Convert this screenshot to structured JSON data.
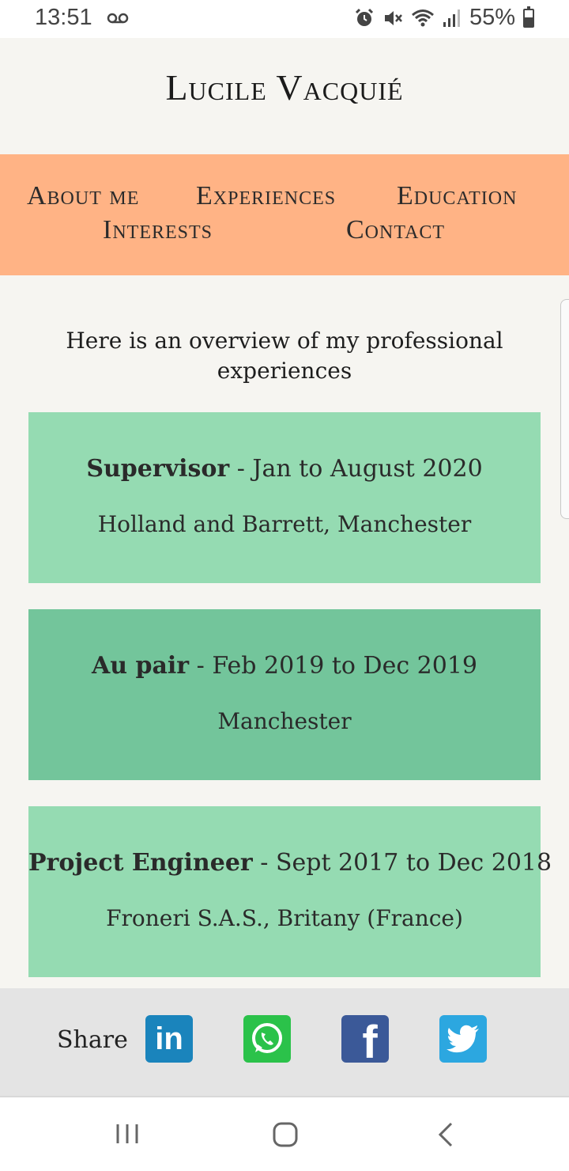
{
  "status_bar": {
    "time": "13:51",
    "battery": "55%",
    "icons": [
      "voicemail-icon",
      "alarm-icon",
      "mute-icon",
      "wifi-icon",
      "signal-icon",
      "battery-icon"
    ]
  },
  "site": {
    "title": "Lucile Vacquié"
  },
  "nav": {
    "items": [
      {
        "label": "About me"
      },
      {
        "label": "Experiences"
      },
      {
        "label": "Education"
      },
      {
        "label": "Interests"
      },
      {
        "label": "Contact"
      }
    ],
    "background": "#ffb385"
  },
  "main": {
    "heading": "Here is an overview of my professional experiences",
    "experiences": [
      {
        "role": "Supervisor",
        "period": " - Jan to August 2020",
        "place": "Holland and Barrett, Manchester",
        "color": "#95dbb2"
      },
      {
        "role": "Au pair",
        "period": " - Feb 2019 to Dec 2019",
        "place": "Manchester",
        "color": "#73c59b"
      },
      {
        "role": "Project Engineer",
        "period": " - Sept 2017 to Dec 2018",
        "place": "Froneri S.A.S., Britany (France)",
        "color": "#95dbb2"
      }
    ]
  },
  "share": {
    "label": "Share",
    "buttons": [
      {
        "icon": "linkedin-icon",
        "color": "#1a84bc",
        "glyph": "in"
      },
      {
        "icon": "whatsapp-icon",
        "color": "#2bc24a"
      },
      {
        "icon": "facebook-icon",
        "color": "#3b5998",
        "glyph": "f"
      },
      {
        "icon": "twitter-icon",
        "color": "#2ca7e0"
      }
    ]
  },
  "system_nav": {
    "icons": [
      "recent-apps-icon",
      "home-icon",
      "back-icon"
    ]
  }
}
